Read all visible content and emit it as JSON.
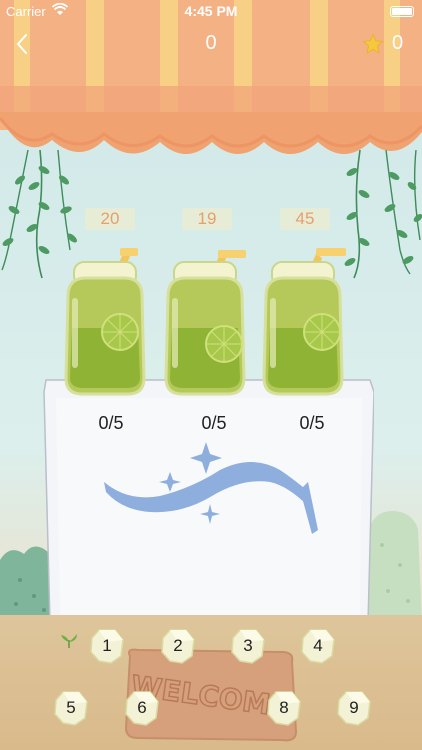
{
  "status_bar": {
    "carrier": "Carrier",
    "time": "4:45 PM"
  },
  "header": {
    "level": "0",
    "star_count": "0"
  },
  "counters": [
    "20",
    "19",
    "45"
  ],
  "jars": [
    {
      "progress": "0/5"
    },
    {
      "progress": "0/5"
    },
    {
      "progress": "0/5"
    }
  ],
  "keypad": {
    "row1": [
      "1",
      "2",
      "3",
      "4"
    ],
    "row2": [
      "5",
      "6",
      "8",
      "9"
    ]
  },
  "mat_text": "WELCOME",
  "colors": {
    "awning_orange": "#f3a878",
    "awning_yellow": "#f7cc7a",
    "juice_green": "#8fb335",
    "star_yellow": "#f6c83c"
  }
}
